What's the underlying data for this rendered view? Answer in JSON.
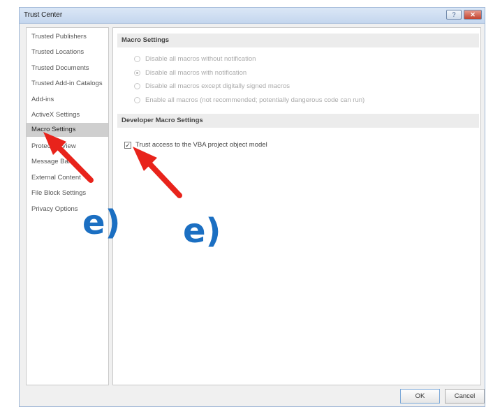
{
  "window": {
    "title": "Trust Center",
    "help_label": "?",
    "close_label": "✕"
  },
  "sidebar": {
    "items": [
      {
        "label": "Trusted Publishers"
      },
      {
        "label": "Trusted Locations"
      },
      {
        "label": "Trusted Documents"
      },
      {
        "label": "Trusted Add-in Catalogs"
      },
      {
        "label": "Add-ins"
      },
      {
        "label": "ActiveX Settings"
      },
      {
        "label": "Macro Settings",
        "selected": true
      },
      {
        "label": "Protected View"
      },
      {
        "label": "Message Bar"
      },
      {
        "label": "External Content"
      },
      {
        "label": "File Block Settings"
      },
      {
        "label": "Privacy Options"
      }
    ]
  },
  "macro_settings": {
    "header": "Macro Settings",
    "options": [
      {
        "label": "Disable all macros without notification",
        "checked": false
      },
      {
        "label": "Disable all macros with notification",
        "checked": true
      },
      {
        "label": "Disable all macros except digitally signed macros",
        "checked": false
      },
      {
        "label": "Enable all macros (not recommended; potentially dangerous code can run)",
        "checked": false
      }
    ]
  },
  "developer_macro_settings": {
    "header": "Developer Macro Settings",
    "trust_vba_label": "Trust access to the VBA project object model",
    "trust_vba_checked": true,
    "check_glyph": "✓"
  },
  "buttons": {
    "ok": "OK",
    "cancel": "Cancel"
  },
  "annotations": {
    "label_left": "e)",
    "label_right": "e)",
    "arrow_color": "#e8231b",
    "label_color": "#1b6fc2"
  }
}
